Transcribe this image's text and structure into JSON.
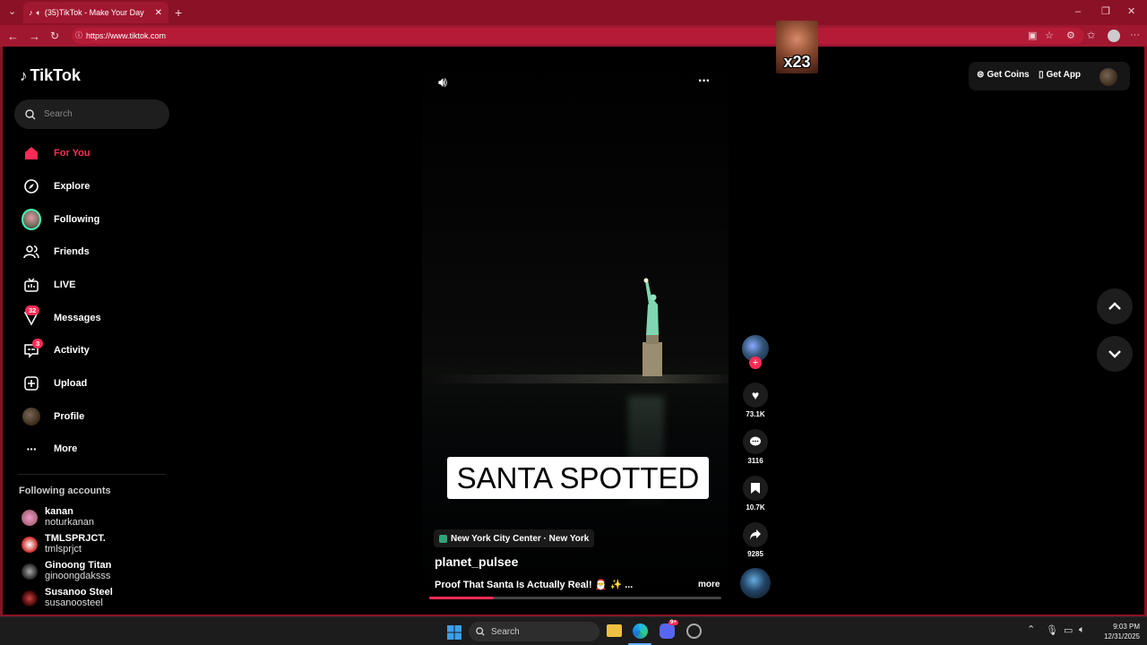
{
  "browser": {
    "tab_title": "(35)TikTok - Make Your Day",
    "url": "https://www.tiktok.com"
  },
  "overlay": {
    "counter": "x23"
  },
  "app": {
    "logo": "TikTok",
    "search_placeholder": "Search",
    "nav": [
      {
        "label": "For You",
        "icon": "home-icon",
        "active": true
      },
      {
        "label": "Explore",
        "icon": "compass-icon"
      },
      {
        "label": "Following",
        "icon": "avatar-icon"
      },
      {
        "label": "Friends",
        "icon": "friends-icon"
      },
      {
        "label": "LIVE",
        "icon": "live-icon"
      },
      {
        "label": "Messages",
        "icon": "messages-icon",
        "badge": "32"
      },
      {
        "label": "Activity",
        "icon": "activity-icon",
        "badge": "3"
      },
      {
        "label": "Upload",
        "icon": "upload-icon"
      },
      {
        "label": "Profile",
        "icon": "profile-avatar-icon"
      },
      {
        "label": "More",
        "icon": "more-icon"
      }
    ],
    "following_title": "Following accounts",
    "accounts": [
      {
        "name": "kanan",
        "username": "noturkanan"
      },
      {
        "name": "TMLSPRJCT.",
        "username": "tmlsprjct"
      },
      {
        "name": "Ginoong Titan",
        "username": "ginoongdaksss"
      },
      {
        "name": "Susanoo Steel",
        "username": "susanoosteel"
      }
    ],
    "header": {
      "get_coins": "Get Coins",
      "get_app": "Get App"
    }
  },
  "video": {
    "caption_overlay": "SANTA SPOTTED",
    "location": "New York City Center · New York",
    "author": "planet_pulsee",
    "description": "Proof That Santa Is Actually Real! 🎅 ✨ ...",
    "more": "more",
    "progress": 0.22,
    "likes": "73.1K",
    "comments": "3116",
    "saves": "10.7K",
    "shares": "9285"
  },
  "taskbar": {
    "search": "Search",
    "time": "9:03 PM",
    "date": "12/31/2025",
    "discord_badge": "9+"
  },
  "colors": {
    "accent": "#fe2c55",
    "browser": "#8a1226"
  }
}
